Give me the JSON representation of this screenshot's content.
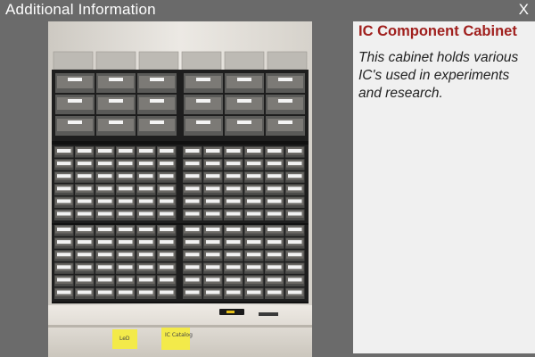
{
  "window": {
    "title": "Additional Information",
    "close_label": "X"
  },
  "colors": {
    "titlebar_bg": "#6a6a6a",
    "heading": "#a0201e",
    "panel_bg": "#f0f0f0"
  },
  "info": {
    "heading": "IC Component Cabinet",
    "description": "This cabinet holds various IC's used in experiments and research."
  },
  "photo": {
    "subject": "cabinet-photo",
    "sticky_notes": [
      {
        "text": "LeD"
      },
      {
        "text": "IC Catalog"
      }
    ]
  }
}
